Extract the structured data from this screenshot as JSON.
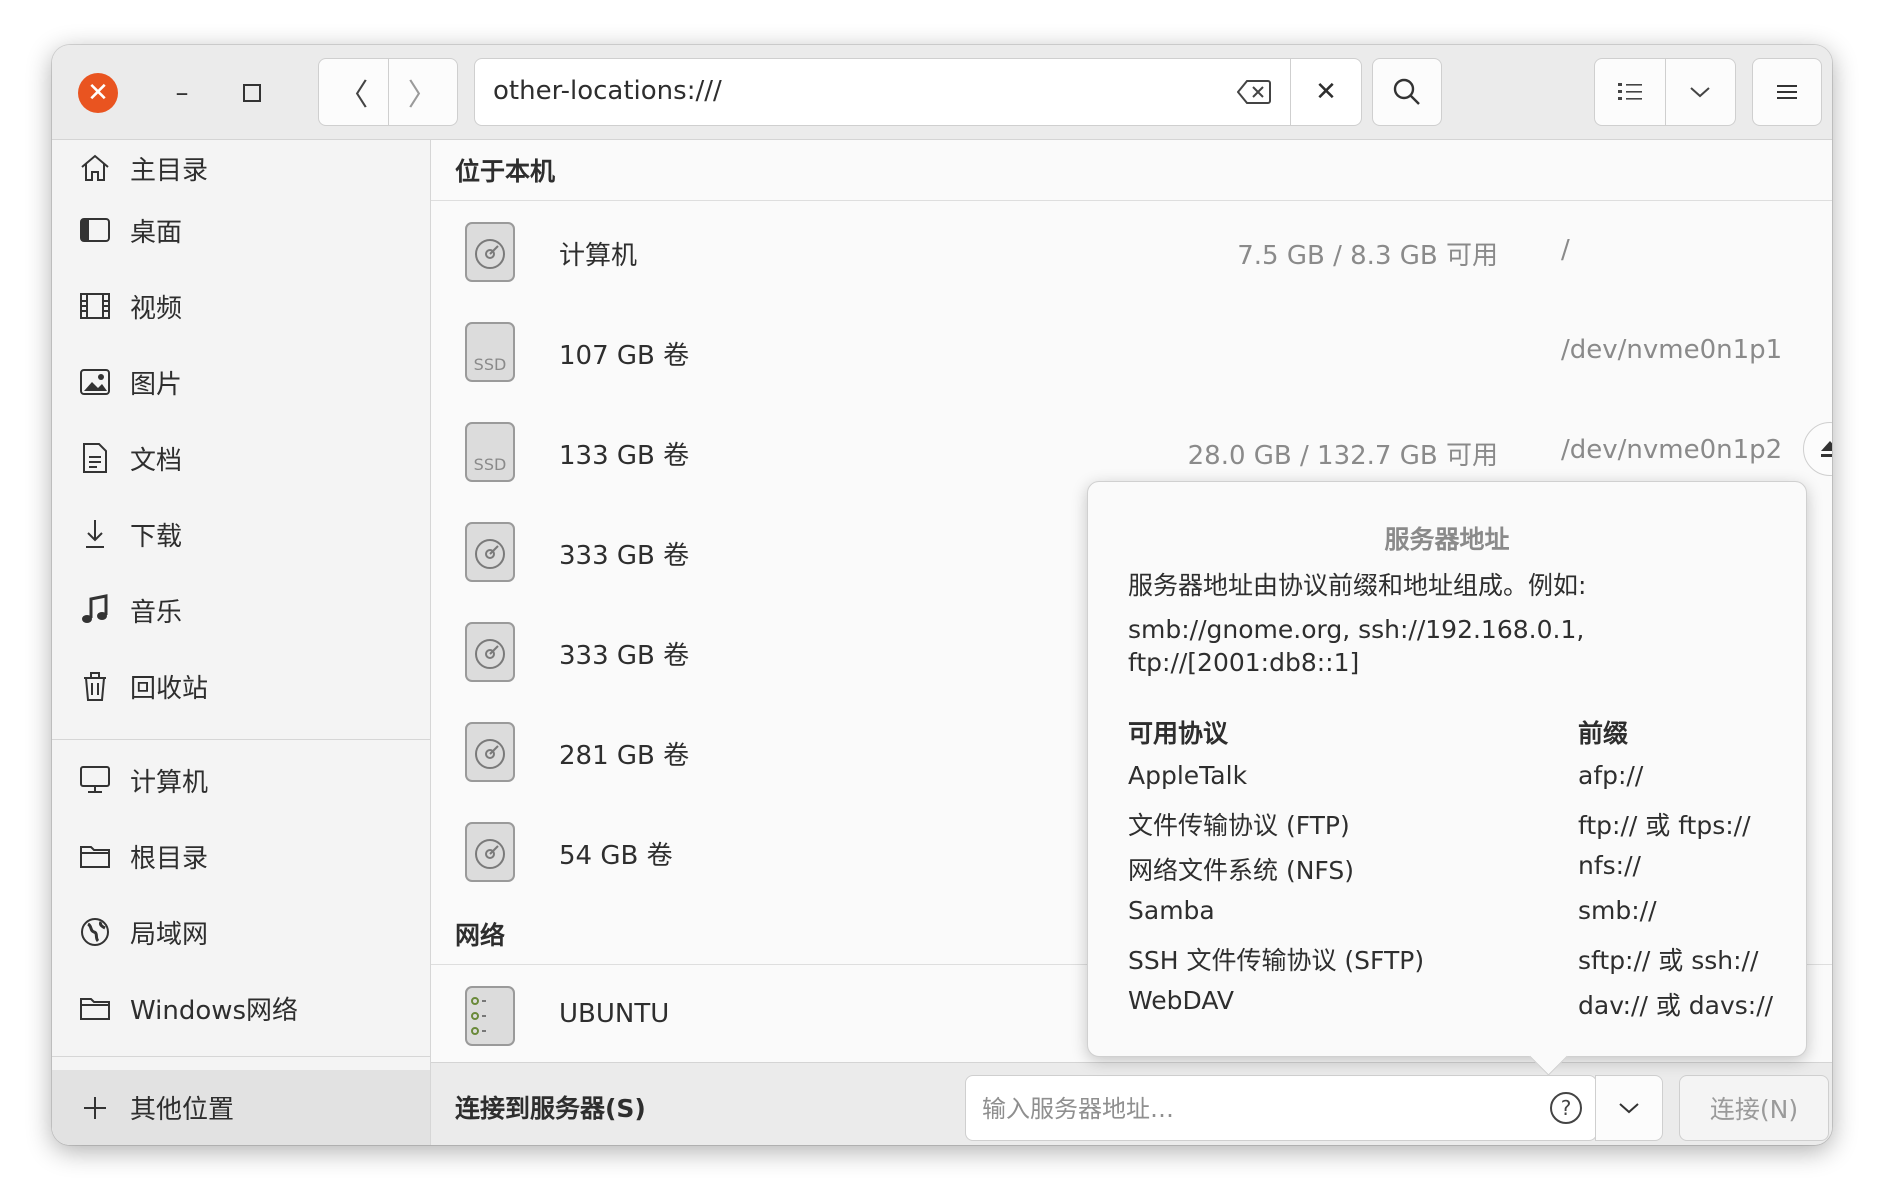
{
  "window": {
    "path": "other-locations:///"
  },
  "sidebar": {
    "items": [
      {
        "label": "主目录",
        "icon": "home-icon"
      },
      {
        "label": "桌面",
        "icon": "desktop-icon"
      },
      {
        "label": "视频",
        "icon": "video-icon"
      },
      {
        "label": "图片",
        "icon": "pictures-icon"
      },
      {
        "label": "文档",
        "icon": "documents-icon"
      },
      {
        "label": "下载",
        "icon": "download-icon"
      },
      {
        "label": "音乐",
        "icon": "music-icon"
      },
      {
        "label": "回收站",
        "icon": "trash-icon"
      }
    ],
    "devices": [
      {
        "label": "计算机",
        "icon": "computer-icon"
      },
      {
        "label": "根目录",
        "icon": "folder-icon"
      },
      {
        "label": "局域网",
        "icon": "globe-icon"
      },
      {
        "label": "Windows网络",
        "icon": "folder-icon"
      }
    ],
    "other_locations": "其他位置"
  },
  "main": {
    "local_title": "位于本机",
    "network_title": "网络",
    "volumes": [
      {
        "name": "计算机",
        "usage": "7.5 GB / 8.3 GB 可用",
        "dev": "/",
        "kind": "disk"
      },
      {
        "name": "107 GB 卷",
        "usage": "",
        "dev": "/dev/nvme0n1p1",
        "kind": "ssd"
      },
      {
        "name": "133 GB 卷",
        "usage": "28.0 GB / 132.7 GB 可用",
        "dev": "/dev/nvme0n1p2",
        "kind": "ssd"
      },
      {
        "name": "333 GB 卷",
        "usage": "",
        "dev": "",
        "kind": "disk"
      },
      {
        "name": "333 GB 卷",
        "usage": "",
        "dev": "",
        "kind": "disk"
      },
      {
        "name": "281 GB 卷",
        "usage": "",
        "dev": "",
        "kind": "disk"
      },
      {
        "name": "54 GB 卷",
        "usage": "",
        "dev": "",
        "kind": "disk"
      }
    ],
    "ssd_badge": "SSD",
    "network": [
      {
        "name": "UBUNTU",
        "kind": "server"
      }
    ]
  },
  "bottom": {
    "connect_label": "连接到服务器(S)",
    "placeholder": "输入服务器地址…",
    "help_glyph": "?",
    "connect_button": "连接(N)"
  },
  "popover": {
    "title": "服务器地址",
    "description": "服务器地址由协议前缀和地址组成。例如:",
    "example": "smb://gnome.org, ssh://192.168.0.1, ftp://[2001:db8::1]",
    "col_protocol": "可用协议",
    "col_prefix": "前缀",
    "protocols": [
      {
        "name": "AppleTalk",
        "prefix": "afp://"
      },
      {
        "name": "文件传输协议 (FTP)",
        "prefix": "ftp:// 或 ftps://"
      },
      {
        "name": "网络文件系统 (NFS)",
        "prefix": "nfs://"
      },
      {
        "name": "Samba",
        "prefix": "smb://"
      },
      {
        "name": "SSH 文件传输协议 (SFTP)",
        "prefix": "sftp:// 或 ssh://"
      },
      {
        "name": "WebDAV",
        "prefix": "dav:// 或 davs://"
      }
    ]
  },
  "colors": {
    "accent_close": "#e95420",
    "header_bg": "#ebebeb",
    "sidebar_bg": "#f4f4f4",
    "muted_text": "#8a8a8a"
  }
}
